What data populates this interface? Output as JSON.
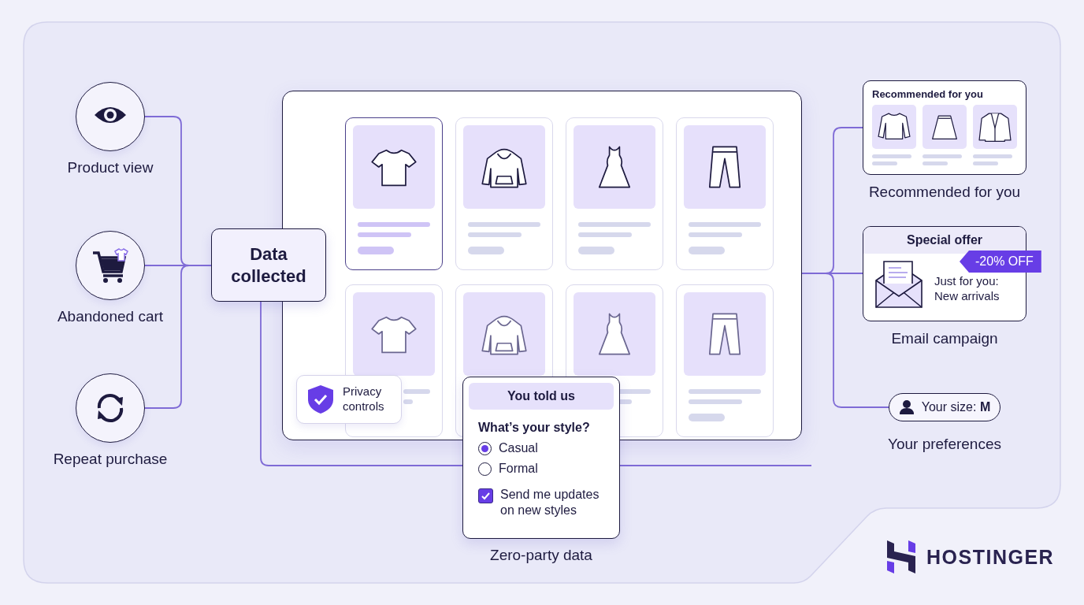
{
  "sources": [
    {
      "label": "Product view"
    },
    {
      "label": "Abandoned cart"
    },
    {
      "label": "Repeat purchase"
    }
  ],
  "hub": {
    "label": "Data collected"
  },
  "storefront": {
    "products": [
      {
        "selected": true
      },
      {
        "selected": false
      },
      {
        "selected": false
      },
      {
        "selected": false
      },
      {
        "selected": false
      },
      {
        "selected": false
      },
      {
        "selected": false
      },
      {
        "selected": false
      }
    ]
  },
  "privacy": {
    "label": "Privacy controls"
  },
  "survey": {
    "header": "You told us",
    "question": "What’s your style?",
    "options": [
      {
        "label": "Casual",
        "selected": true
      },
      {
        "label": "Formal",
        "selected": false
      }
    ],
    "consent": {
      "label": "Send me updates on new styles",
      "checked": true
    },
    "caption": "Zero-party data"
  },
  "outputs": [
    {
      "kind": "recommendations",
      "card_title": "Recommended for you",
      "caption": "Recommended for you"
    },
    {
      "kind": "email",
      "card_title": "Special offer",
      "badge": "-20% OFF",
      "message": "Just for you: New arrivals",
      "caption": "Email campaign"
    },
    {
      "kind": "preference",
      "pill": "Your size: **M**",
      "caption": "Your preferences"
    }
  ],
  "brand": {
    "name": "HOSTINGER"
  }
}
